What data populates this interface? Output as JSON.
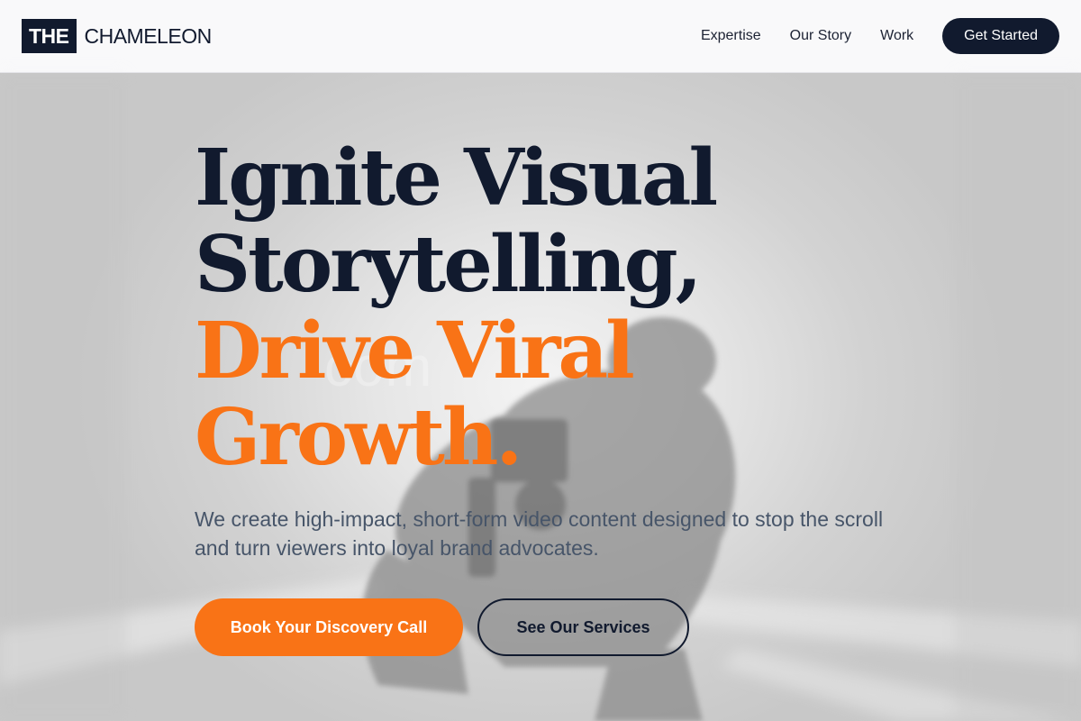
{
  "header": {
    "logo_box": "THE",
    "logo_text": "CHAMELEON",
    "nav": [
      {
        "label": "Expertise"
      },
      {
        "label": "Our Story"
      },
      {
        "label": "Work"
      }
    ],
    "cta_label": "Get Started"
  },
  "hero": {
    "headline_lines": [
      "Ignite Visual",
      "Storytelling,",
      "Drive Viral",
      "Growth."
    ],
    "subtext": "We create high-impact, short-form video content designed to stop the scroll and turn viewers into loyal brand advocates.",
    "primary_button": "Book Your Discovery Call",
    "secondary_button": "See Our Services",
    "watermark": "com"
  },
  "colors": {
    "navy": "#111a2e",
    "accent_orange": "#f97316",
    "body_text": "#475569"
  }
}
